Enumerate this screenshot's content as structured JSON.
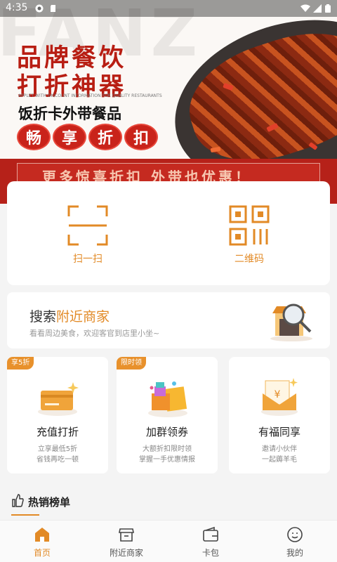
{
  "status_bar": {
    "time": "4:35"
  },
  "banner": {
    "watermark": "FANZ",
    "line1": "品牌餐饮",
    "line2": "打折神器",
    "english": "APPLET WITH DISCOUNT INFORMATION FOR QUALITY RESTAURANTS",
    "subtitle": "饭折卡外带餐品",
    "pills": [
      "畅",
      "享",
      "折",
      "扣"
    ],
    "ribbon_text": "更多惊喜折扣  外带也优惠！"
  },
  "quick_actions": [
    {
      "label": "扫一扫",
      "icon": "scan-icon"
    },
    {
      "label": "二维码",
      "icon": "qrcode-icon"
    }
  ],
  "nearby": {
    "title_plain": "搜索",
    "title_highlight": "附近商家",
    "subtitle": "看看周边美食，欢迎客官到店里小坐~",
    "icon": "shop-search-icon"
  },
  "promos": [
    {
      "badge": "享5折",
      "title": "充值打折",
      "line1": "立享最低5折",
      "line2": "省钱再吃一顿",
      "icon": "card-icon"
    },
    {
      "badge": "限时领",
      "title": "加群领券",
      "line1": "大额折扣限时领",
      "line2": "掌握一手优惠情报",
      "icon": "gift-icon"
    },
    {
      "badge": "",
      "title": "有福同享",
      "line1": "邀请小伙伴",
      "line2": "一起薅羊毛",
      "icon": "envelope-icon"
    }
  ],
  "hot_list": {
    "label": "热销榜单",
    "icon": "thumb-icon"
  },
  "tabs": [
    {
      "label": "首页",
      "icon": "home-icon",
      "active": true
    },
    {
      "label": "附近商家",
      "icon": "store-icon",
      "active": false
    },
    {
      "label": "卡包",
      "icon": "wallet-icon",
      "active": false
    },
    {
      "label": "我的",
      "icon": "profile-icon",
      "active": false
    }
  ],
  "colors": {
    "accent": "#e28a26",
    "banner_red": "#b81e13",
    "background": "#f4f4f4"
  }
}
